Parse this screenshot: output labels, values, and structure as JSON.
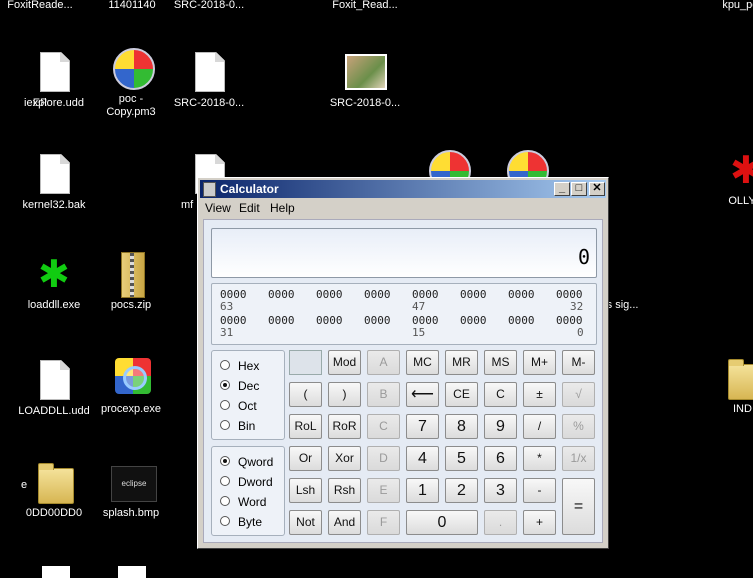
{
  "desktop": {
    "top_labels": [
      "FoxitReade...",
      "11401140",
      "SRC-2018-0...",
      "Foxit_Read...",
      "kpu_peu..."
    ],
    "icons": [
      {
        "label": "ER",
        "type": "doc"
      },
      {
        "label": "iexplore.udd",
        "type": "doc"
      },
      {
        "label": "poc - Copy.pm3",
        "type": "ball"
      },
      {
        "label": "SRC-2018-0...",
        "type": "doc"
      },
      {
        "label": "SRC-2018-0...",
        "type": "photo"
      },
      {
        "label": "kernel32.bak",
        "type": "doc"
      },
      {
        "label": "mf",
        "type": "doc"
      },
      {
        "label": "OLLYD",
        "type": "splat-red"
      },
      {
        "label": "loaddll.exe",
        "type": "splat"
      },
      {
        "label": "pocs.zip",
        "type": "zip"
      },
      {
        "label": "kess sig...",
        "type": "partial"
      },
      {
        "label": "LOADDLL.udd",
        "type": "doc"
      },
      {
        "label": "procexp.exe",
        "type": "procexp"
      },
      {
        "label": "INDI",
        "type": "folder"
      },
      {
        "label": "0DD00DD0",
        "type": "folder"
      },
      {
        "label": "splash.bmp",
        "type": "eclipse"
      },
      {
        "label": "e",
        "type": "none"
      }
    ]
  },
  "calculator": {
    "title": "Calculator",
    "window_buttons": {
      "minimize": "_",
      "maximize": "□",
      "close": "✕"
    },
    "menu": [
      "View",
      "Edit",
      "Help"
    ],
    "display_value": "0",
    "bits": {
      "row1": [
        "0000",
        "0000",
        "0000",
        "0000",
        "0000",
        "0000",
        "0000",
        "0000"
      ],
      "row1_pos": [
        "63",
        "47",
        "32"
      ],
      "row2": [
        "0000",
        "0000",
        "0000",
        "0000",
        "0000",
        "0000",
        "0000",
        "0000"
      ],
      "row2_pos": [
        "31",
        "15",
        "0"
      ]
    },
    "base_options": [
      "Hex",
      "Dec",
      "Oct",
      "Bin"
    ],
    "base_selected": "Dec",
    "word_options": [
      "Qword",
      "Dword",
      "Word",
      "Byte"
    ],
    "word_selected": "Qword",
    "keys": {
      "mod": "Mod",
      "A": "A",
      "MC": "MC",
      "MR": "MR",
      "MS": "MS",
      "Mplus": "M+",
      "Mminus": "M-",
      "lparen": "(",
      "rparen": ")",
      "B": "B",
      "back": "⟵",
      "CE": "CE",
      "C": "C",
      "pm": "±",
      "sqrt": "√",
      "RoL": "RoL",
      "RoR": "RoR",
      "Ckey": "C",
      "n7": "7",
      "n8": "8",
      "n9": "9",
      "div": "/",
      "pct": "%",
      "Or": "Or",
      "Xor": "Xor",
      "D": "D",
      "n4": "4",
      "n5": "5",
      "n6": "6",
      "mul": "*",
      "recip": "1/x",
      "Lsh": "Lsh",
      "Rsh": "Rsh",
      "E": "E",
      "n1": "1",
      "n2": "2",
      "n3": "3",
      "sub": "-",
      "eq": "=",
      "Not": "Not",
      "And": "And",
      "F": "F",
      "n0": "0",
      "dot": ".",
      "add": "+"
    }
  },
  "colors": {
    "desktop": "#000000",
    "titlebar": "#0a246a",
    "window": "#d4d0c8"
  }
}
